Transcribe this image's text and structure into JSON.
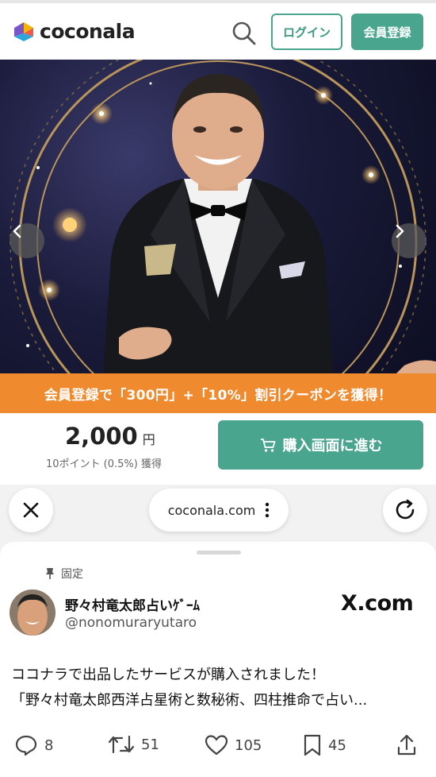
{
  "header": {
    "logo_text": "coconala",
    "login_label": "ログイン",
    "register_label": "会員登録"
  },
  "hero": {
    "prev_arrow": "chevron-left",
    "next_arrow": "chevron-right"
  },
  "coupon": {
    "text": "会員登録で「300円」+「10%」割引クーポンを獲得！"
  },
  "price": {
    "value": "2,000",
    "unit": "円",
    "points": "10ポイント (0.5%) 獲得",
    "buy_label": "購入画面に進む"
  },
  "browser": {
    "url": "coconala.com"
  },
  "tweet": {
    "pinned_label": "固定",
    "display_name": "野々村竜太郎占いｹﾞｰﾑ",
    "handle": "@nonomuraryutaro",
    "source": "X.com",
    "text_line1": "ココナラで出品したサービスが購入されました！",
    "text_line2": "「野々村竜太郎西洋占星術と数秘術、四柱推命で占い...",
    "replies": "8",
    "retweets": "51",
    "likes": "105",
    "bookmarks": "45"
  },
  "colors": {
    "brand_green": "#4aa58f",
    "coupon_orange": "#ef8a2e"
  }
}
